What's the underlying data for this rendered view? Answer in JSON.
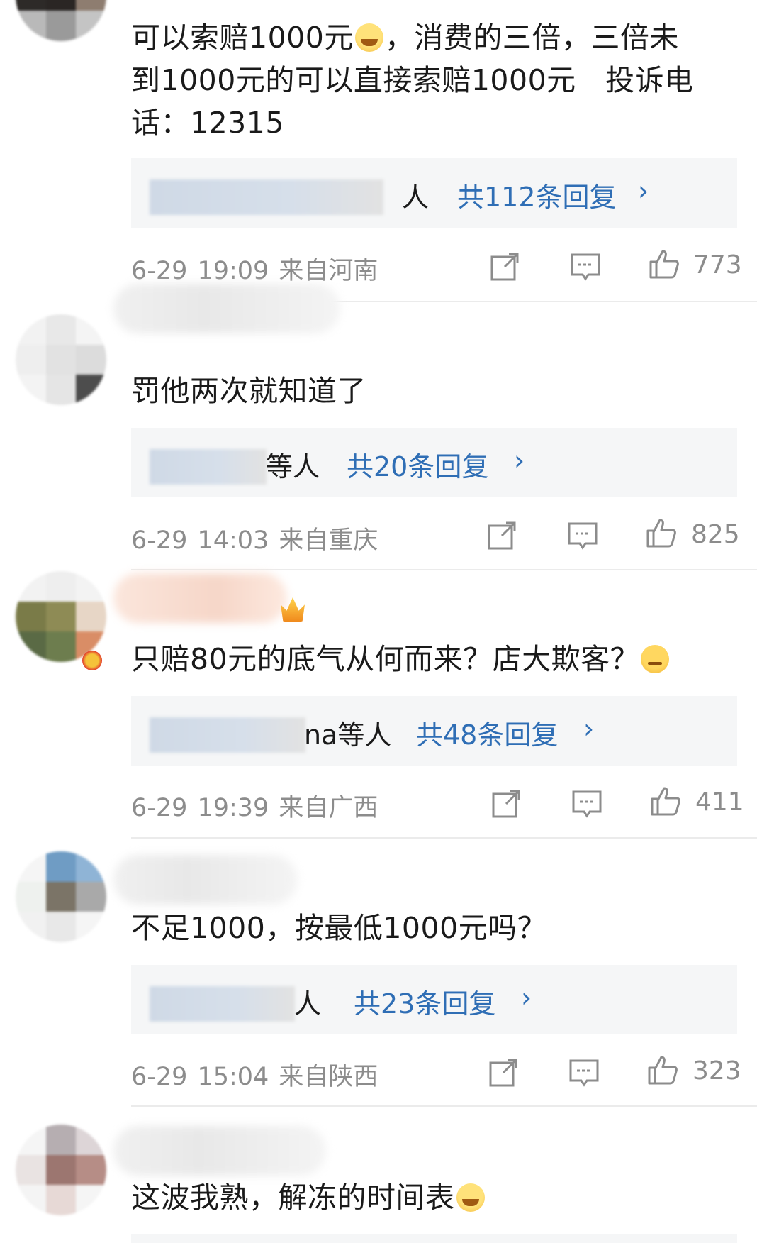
{
  "comments": [
    {
      "text_lines": [
        "可以索赔1000元",
        "，消费的三倍，三倍未",
        "到1000元的可以直接索赔1000元　投诉电",
        "话：12315"
      ],
      "reply_names_suffix": "人",
      "reply_count": "共112条回复",
      "date": "6-29",
      "time": "19:09",
      "location": "来自河南",
      "likes": "773"
    },
    {
      "text": "罚他两次就知道了",
      "reply_names_suffix": "等人",
      "reply_count": "共20条回复",
      "date": "6-29",
      "time": "14:03",
      "location": "来自重庆",
      "likes": "825"
    },
    {
      "text": "只赔80元的底气从何而来？店大欺客？",
      "reply_names_suffix": "na等人",
      "reply_count": "共48条回复",
      "date": "6-29",
      "time": "19:39",
      "location": "来自广西",
      "likes": "411"
    },
    {
      "text": "不足1000，按最低1000元吗？",
      "reply_names_suffix": "人",
      "reply_count": "共23条回复",
      "date": "6-29",
      "time": "15:04",
      "location": "来自陕西",
      "likes": "323"
    },
    {
      "text": "这波我熟，解冻的时间表"
    }
  ],
  "reply_arrow": "›",
  "icons": {
    "share": "share-icon",
    "comment": "comment-icon",
    "like": "like-icon",
    "emoji_laugh": "laugh-cry-emoji-icon",
    "emoji_shrug": "shrug-emoji-icon",
    "crown": "crown-badge-icon"
  },
  "colors": {
    "link_blue": "#2f6eb5",
    "meta_gray": "#8c8c8c",
    "reply_bg": "#f5f6f7"
  }
}
